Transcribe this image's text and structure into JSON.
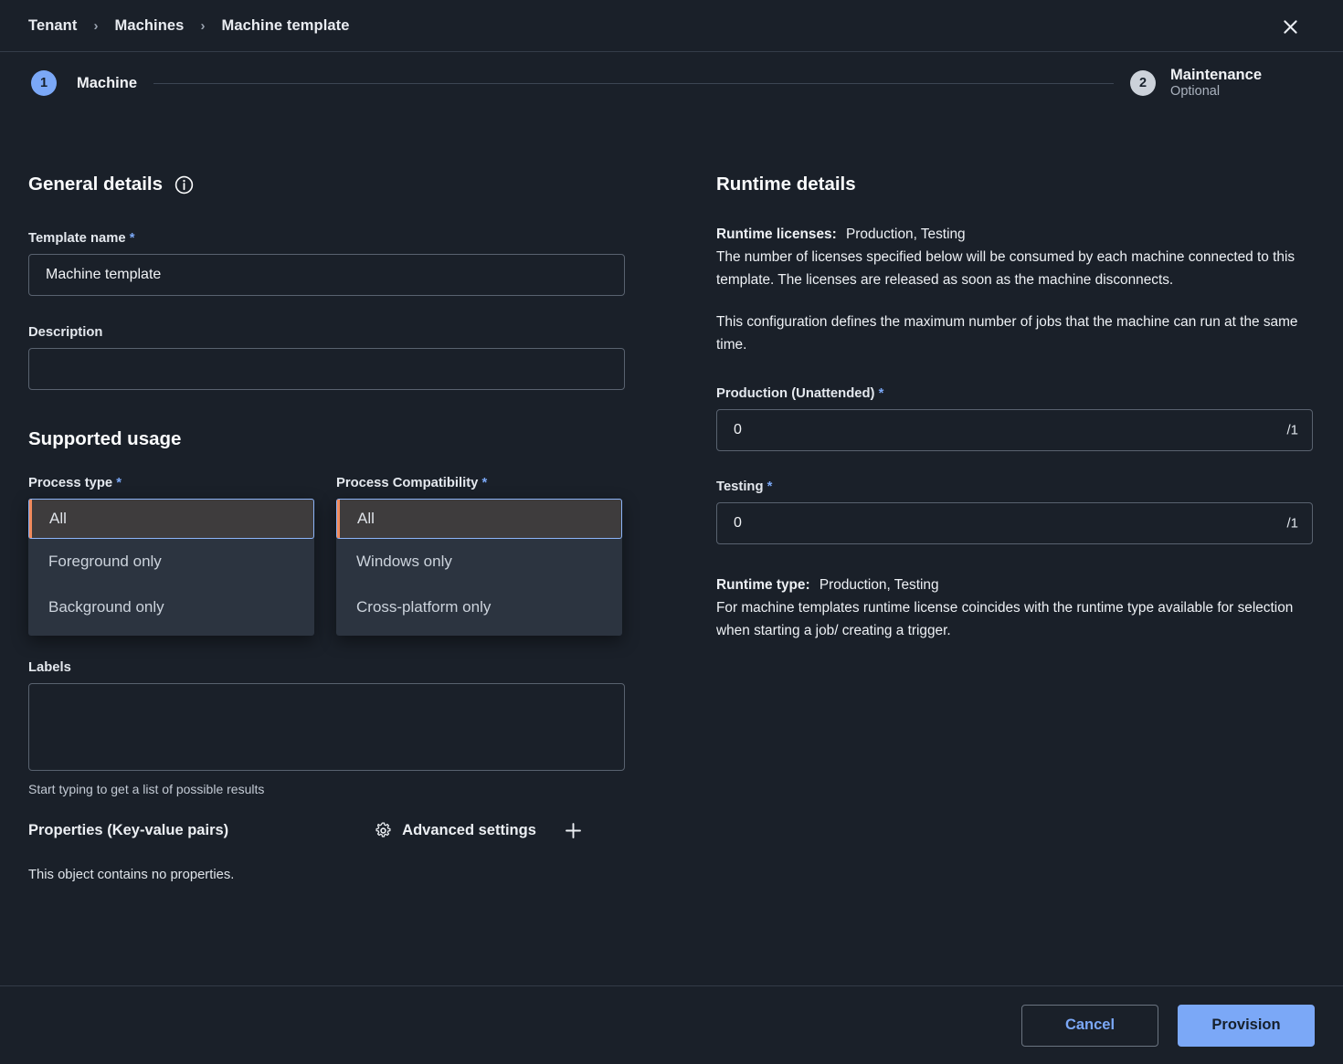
{
  "breadcrumb": {
    "items": [
      "Tenant",
      "Machines",
      "Machine template"
    ],
    "separator": "›",
    "close_label": "✕"
  },
  "stepper": {
    "step1": {
      "number": "1",
      "label": "Machine"
    },
    "step2": {
      "number": "2",
      "label": "Maintenance",
      "sublabel": "Optional"
    }
  },
  "general": {
    "title": "General details",
    "info_icon": "info-icon",
    "template_name_label": "Template name",
    "template_name_value": "Machine template",
    "template_name_placeholder": "",
    "description_label": "Description",
    "description_value": "",
    "description_placeholder": ""
  },
  "usage": {
    "title": "Supported usage",
    "process_type": {
      "label": "Process type",
      "selected": "All",
      "options": [
        "Foreground only",
        "Background only"
      ]
    },
    "process_compatibility": {
      "label": "Process Compatibility",
      "selected": "All",
      "options": [
        "Windows only",
        "Cross-platform only"
      ]
    }
  },
  "labels": {
    "label": "Labels",
    "value": "",
    "placeholder": "",
    "hint": "Start typing to get a list of possible results"
  },
  "properties": {
    "title": "Properties (Key-value pairs)",
    "advanced_settings_label": "Advanced settings",
    "gear_icon": "gear-icon",
    "add_icon": "plus-icon",
    "empty_text": "This object contains no properties."
  },
  "runtime": {
    "title": "Runtime details",
    "licenses_label": "Runtime licenses:",
    "licenses_value": "Production, Testing",
    "licenses_desc": "The number of licenses specified below will be consumed by each machine connected to this template. The licenses are released as soon as the machine disconnects.",
    "config_desc": "This configuration defines the maximum number of jobs that the machine can run at the same time.",
    "production_label": "Production (Unattended)",
    "production_value": "0",
    "production_suffix": "/1",
    "testing_label": "Testing",
    "testing_value": "0",
    "testing_suffix": "/1",
    "type_label": "Runtime type:",
    "type_value": "Production, Testing",
    "type_desc": "For machine templates runtime license coincides with the runtime type available for selection when starting a job/ creating a trigger."
  },
  "footer": {
    "cancel_label": "Cancel",
    "provision_label": "Provision"
  },
  "required_marker": "*",
  "colors": {
    "background": "#1a2029",
    "accent_blue": "#7ba8f7",
    "accent_orange": "#f08a5d",
    "dropdown_bg": "#2c3440",
    "selected_bg": "#3e3c3d",
    "border": "#59626f"
  }
}
